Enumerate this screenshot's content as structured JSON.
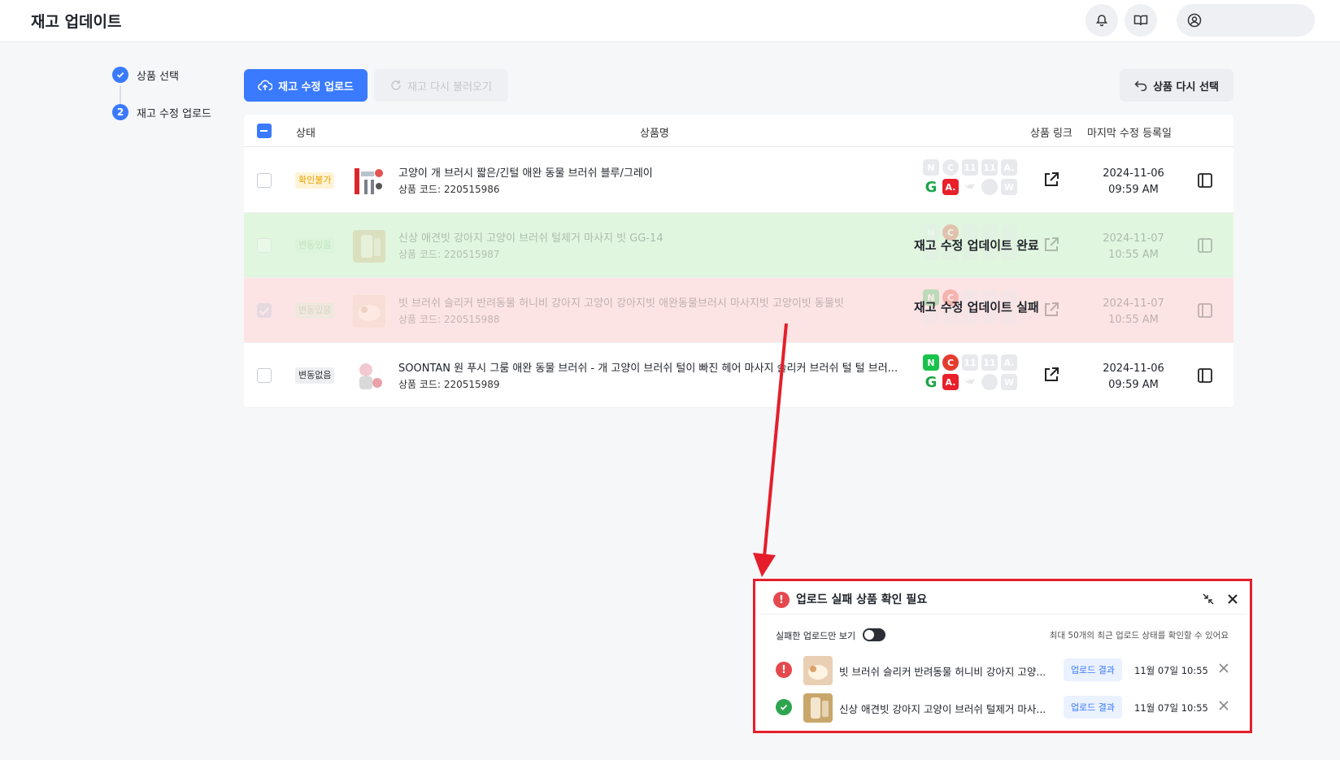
{
  "header": {
    "title": "재고 업데이트"
  },
  "stepper": {
    "steps": [
      {
        "label": "상품 선택",
        "number": "✓"
      },
      {
        "label": "재고 수정 업로드",
        "number": "2"
      }
    ]
  },
  "toolbar": {
    "upload_label": "재고 수정 업로드",
    "reload_label": "재고 다시 불러오기",
    "reselect_label": "상품 다시 선택"
  },
  "table": {
    "columns": {
      "status": "상태",
      "name": "상품명",
      "link": "상품 링크",
      "last_modified": "마지막 수정 등록일"
    },
    "rows": [
      {
        "status": "확인불가",
        "name": "고양이 개 브러시 짧은/긴털 애완 동물 브러쉬 블루/그레이",
        "code": "상품 코드: 220515986",
        "date": "2024-11-06",
        "time": "09:59 AM"
      },
      {
        "status": "변동있음",
        "name": "신상 애견빗 강아지 고양이 브러쉬 털제거 마사지 빗 GG-14",
        "code": "상품 코드: 220515987",
        "date": "2024-11-07",
        "time": "10:55 AM",
        "overlay": "재고 수정 업데이트 완료"
      },
      {
        "status": "변동있음",
        "name": "빗 브러쉬 슬리커 반려동물 허니비 강아지 고양이 강아지빗 애완동물브러시 마사지빗 고양이빗 동물빗",
        "code": "상품 코드: 220515988",
        "date": "2024-11-07",
        "time": "10:55 AM",
        "overlay": "재고 수정 업데이트 실패"
      },
      {
        "status": "변동없음",
        "name": "SOONTAN 원 푸시 그룸 애완 동물 브러쉬 - 개 고양이 브러쉬 털이 빠진 헤어 마사지 슬리커 브러쉬 털 털 브러...",
        "code": "상품 코드: 220515989",
        "date": "2024-11-06",
        "time": "09:59 AM"
      }
    ],
    "channel_letters": {
      "n": "N",
      "c": "C",
      "g": "G",
      "a": "A.",
      "eleven": "11",
      "w": "W"
    }
  },
  "toast": {
    "title": "업로드 실패 상품 확인 필요",
    "filter_label": "실패한 업로드만 보기",
    "note": "최대 50개의 최근 업로드 상태를 확인할 수 있어요",
    "items": [
      {
        "name": "빗 브러쉬 슬리커 반려동물 허니비 강아지 고양...",
        "button": "업로드 결과",
        "time": "11월 07일 10:55",
        "state": "error"
      },
      {
        "name": "신상 애견빗 강아지 고양이 브러쉬 털제거 마사...",
        "button": "업로드 결과",
        "time": "11월 07일 10:55",
        "state": "success"
      }
    ]
  },
  "colors": {
    "accent": "#3a7afe",
    "success_row": "#e1f6df",
    "fail_row": "#fde4e4",
    "annotation_red": "#e41f2b"
  }
}
